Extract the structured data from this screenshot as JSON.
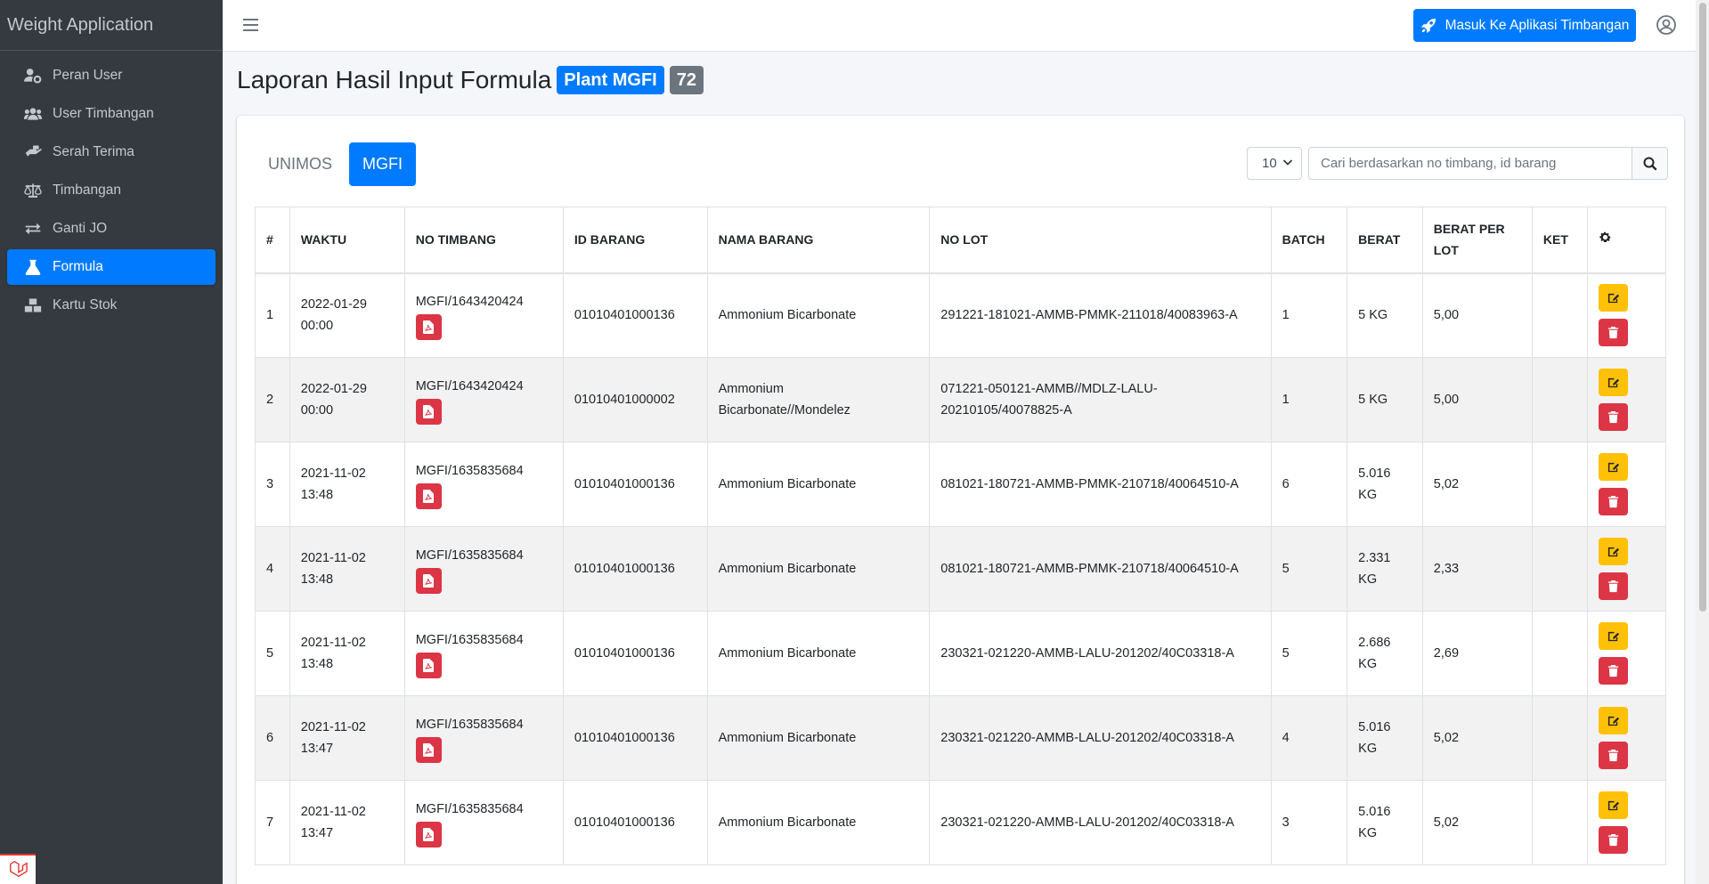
{
  "app": {
    "title": "Weight Application"
  },
  "sidebar": {
    "items": [
      {
        "label": "Peran User",
        "icon": "user-cog-icon",
        "active": false
      },
      {
        "label": "User Timbangan",
        "icon": "users-icon",
        "active": false
      },
      {
        "label": "Serah Terima",
        "icon": "hand-holding-icon",
        "active": false
      },
      {
        "label": "Timbangan",
        "icon": "balance-scale-icon",
        "active": false
      },
      {
        "label": "Ganti JO",
        "icon": "exchange-icon",
        "active": false
      },
      {
        "label": "Formula",
        "icon": "flask-icon",
        "active": true
      },
      {
        "label": "Kartu Stok",
        "icon": "boxes-icon",
        "active": false
      }
    ]
  },
  "topbar": {
    "action_label": "Masuk Ke Aplikasi Timbangan"
  },
  "page": {
    "title": "Laporan Hasil Input Formula",
    "plant_badge": "Plant MGFI",
    "count_badge": "72"
  },
  "tabs": [
    {
      "label": "UNIMOS",
      "active": false
    },
    {
      "label": "MGFI",
      "active": true
    }
  ],
  "filters": {
    "per_page": "10",
    "search_placeholder": "Cari berdasarkan no timbang, id barang"
  },
  "table": {
    "headers": [
      "#",
      "WAKTU",
      "NO TIMBANG",
      "ID BARANG",
      "NAMA BARANG",
      "NO LOT",
      "BATCH",
      "BERAT",
      "BERAT PER LOT",
      "KET"
    ],
    "rows": [
      {
        "no": "1",
        "waktu": "2022-01-29 00:00",
        "no_timbang": "MGFI/1643420424",
        "id_barang": "01010401000136",
        "nama_barang": "Ammonium Bicarbonate",
        "no_lot": "291221-181021-AMMB-PMMK-211018/40083963-A",
        "batch": "1",
        "berat": "5 KG",
        "berat_per_lot": "5,00",
        "ket": ""
      },
      {
        "no": "2",
        "waktu": "2022-01-29 00:00",
        "no_timbang": "MGFI/1643420424",
        "id_barang": "01010401000002",
        "nama_barang": "Ammonium Bicarbonate//Mondelez",
        "no_lot": "071221-050121-AMMB//MDLZ-LALU-20210105/40078825-A",
        "batch": "1",
        "berat": "5 KG",
        "berat_per_lot": "5,00",
        "ket": ""
      },
      {
        "no": "3",
        "waktu": "2021-11-02 13:48",
        "no_timbang": "MGFI/1635835684",
        "id_barang": "01010401000136",
        "nama_barang": "Ammonium Bicarbonate",
        "no_lot": "081021-180721-AMMB-PMMK-210718/40064510-A",
        "batch": "6",
        "berat": "5.016 KG",
        "berat_per_lot": "5,02",
        "ket": ""
      },
      {
        "no": "4",
        "waktu": "2021-11-02 13:48",
        "no_timbang": "MGFI/1635835684",
        "id_barang": "01010401000136",
        "nama_barang": "Ammonium Bicarbonate",
        "no_lot": "081021-180721-AMMB-PMMK-210718/40064510-A",
        "batch": "5",
        "berat": "2.331 KG",
        "berat_per_lot": "2,33",
        "ket": ""
      },
      {
        "no": "5",
        "waktu": "2021-11-02 13:48",
        "no_timbang": "MGFI/1635835684",
        "id_barang": "01010401000136",
        "nama_barang": "Ammonium Bicarbonate",
        "no_lot": "230321-021220-AMMB-LALU-201202/40C03318-A",
        "batch": "5",
        "berat": "2.686 KG",
        "berat_per_lot": "2,69",
        "ket": ""
      },
      {
        "no": "6",
        "waktu": "2021-11-02 13:47",
        "no_timbang": "MGFI/1635835684",
        "id_barang": "01010401000136",
        "nama_barang": "Ammonium Bicarbonate",
        "no_lot": "230321-021220-AMMB-LALU-201202/40C03318-A",
        "batch": "4",
        "berat": "5.016 KG",
        "berat_per_lot": "5,02",
        "ket": ""
      },
      {
        "no": "7",
        "waktu": "2021-11-02 13:47",
        "no_timbang": "MGFI/1635835684",
        "id_barang": "01010401000136",
        "nama_barang": "Ammonium Bicarbonate",
        "no_lot": "230321-021220-AMMB-LALU-201202/40C03318-A",
        "batch": "3",
        "berat": "5.016 KG",
        "berat_per_lot": "5,02",
        "ket": ""
      }
    ]
  },
  "colors": {
    "primary": "#007bff",
    "sidebar_bg": "#343a40",
    "danger": "#dc3545",
    "warning": "#ffc107",
    "secondary": "#6c757d"
  }
}
